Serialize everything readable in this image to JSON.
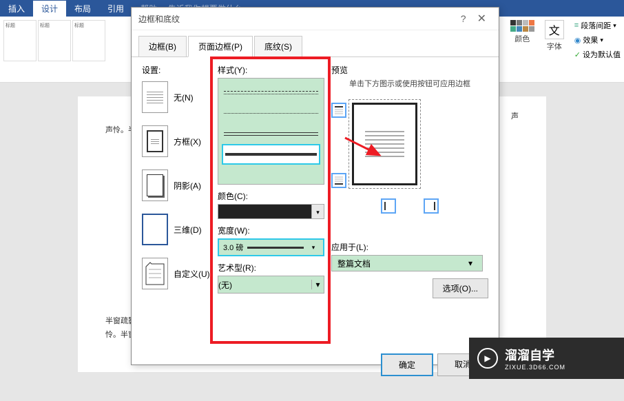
{
  "ribbon": {
    "tabs": [
      "插入",
      "设计",
      "布局",
      "引用"
    ],
    "truncated_tabs": "帮助 ♀ 告诉我你想要做什么",
    "themes": {
      "label1": "标题",
      "label2": "标题",
      "tiny1": "标题 1",
      "tiny2": "标题1"
    },
    "colors_label": "颜色",
    "fonts_label": "字体",
    "font_char": "文",
    "spacing": "段落间距",
    "effects": "效果",
    "default": "设为默认值"
  },
  "dialog": {
    "title": "边框和底纹",
    "help": "?",
    "close": "✕",
    "tabs": {
      "border": "边框(B)",
      "page_border": "页面边框(P)",
      "shading": "底纹(S)"
    },
    "settings_label": "设置:",
    "setting_none": "无(N)",
    "setting_box": "方框(X)",
    "setting_shadow": "阴影(A)",
    "setting_3d": "三维(D)",
    "setting_custom": "自定义(U)",
    "style_label": "样式(Y):",
    "color_label": "颜色(C):",
    "width_label": "宽度(W):",
    "width_value": "3.0 磅",
    "art_label": "艺术型(R):",
    "art_value": "(无)",
    "preview_label": "预览",
    "preview_hint": "单击下方图示或使用按钮可应用边框",
    "apply_label": "应用于(L):",
    "apply_value": "整篇文档",
    "options_btn": "选项(O)...",
    "ok": "确定",
    "cancel": "取消"
  },
  "doc_text": {
    "l1_a": "声",
    "l1_b": "声怜。半窗疏影，一梦千年，琴歌萧萧笛声怜。半窗疏影，一梦千年，琴歌萧萧",
    "l2": "半窗疏影，一梦千年，琴歌萧萧笛声怜。半窗疏影，一梦千年，琴",
    "l3": "怜。半窗疏影，一梦千年，琴歌萧萧笛声怜。半窗疏影，一梦千年，琴歌萧萧笛"
  },
  "watermark": {
    "main": "溜溜自学",
    "sub": "ZIXUE.3D66.COM"
  }
}
